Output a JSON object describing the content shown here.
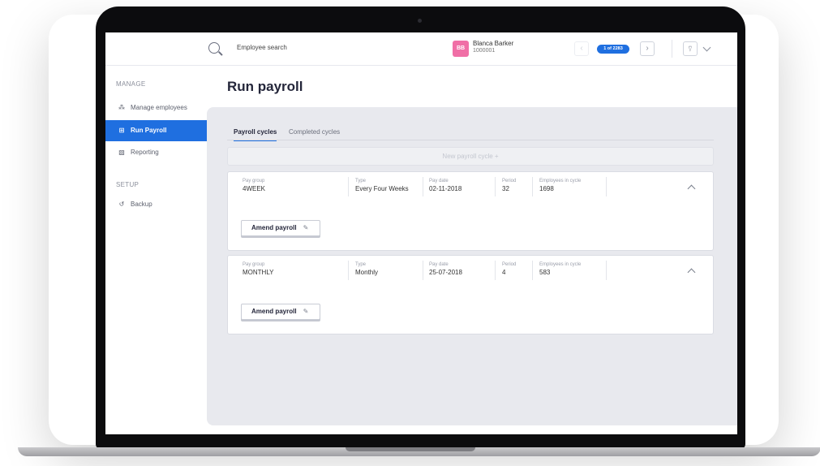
{
  "header": {
    "search_placeholder": "Employee search",
    "employee": {
      "initials": "BB",
      "name": "Blanca Barker",
      "id": "1000001"
    },
    "record_counter": "1 of 2283",
    "prev_icon": "‹",
    "next_icon": "›",
    "user_icon": "⍢"
  },
  "sidebar": {
    "manage_label": "MANAGE",
    "setup_label": "SETUP",
    "items": [
      {
        "label": "Manage employees",
        "icon": "⁂"
      },
      {
        "label": "Run Payroll",
        "icon": "⊞"
      },
      {
        "label": "Reporting",
        "icon": "▧"
      },
      {
        "label": "Backup",
        "icon": "↺"
      }
    ]
  },
  "main": {
    "title": "Run payroll",
    "tabs": [
      {
        "label": "Payroll cycles",
        "active": true
      },
      {
        "label": "Completed cycles",
        "active": false
      }
    ],
    "new_cycle_label": "New payroll cycle  +",
    "field_labels": {
      "pay_group": "Pay group",
      "type": "Type",
      "pay_date": "Pay date",
      "period": "Period",
      "employees": "Employees in cycle"
    },
    "cycles": [
      {
        "pay_group": "4WEEK",
        "type": "Every Four Weeks",
        "pay_date": "02-11-2018",
        "period": "32",
        "employees": "1698",
        "button_label": "Amend payroll"
      },
      {
        "pay_group": "MONTHLY",
        "type": "Monthly",
        "pay_date": "25-07-2018",
        "period": "4",
        "employees": "583",
        "button_label": "Amend payroll"
      }
    ]
  },
  "colors": {
    "accent": "#1f6fe0",
    "avatar": "#f06fa6",
    "content_bg": "#e8e9ee"
  }
}
